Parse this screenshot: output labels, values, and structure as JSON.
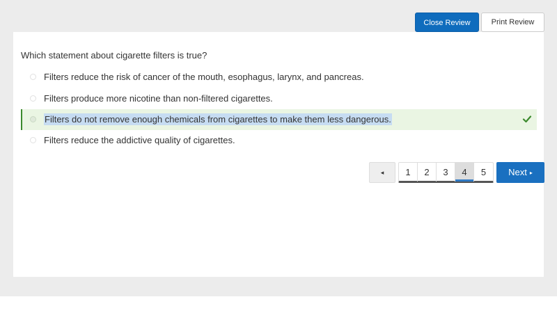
{
  "header": {
    "close_review_label": "Close Review",
    "print_review_label": "Print Review"
  },
  "question": {
    "text": "Which statement about cigarette filters is true?",
    "options": [
      {
        "text": "Filters reduce the risk of cancer of the mouth, esophagus, larynx, and pancreas.",
        "correct": false
      },
      {
        "text": "Filters produce more nicotine than non-filtered cigarettes.",
        "correct": false
      },
      {
        "text": "Filters do not remove enough chemicals from cigarettes to make them less dangerous.",
        "correct": true
      },
      {
        "text": "Filters reduce the addictive quality of cigarettes.",
        "correct": false
      }
    ]
  },
  "pagination": {
    "prev_icon": "◂",
    "pages": [
      "1",
      "2",
      "3",
      "4",
      "5"
    ],
    "current_page": "4",
    "next_label": "Next",
    "next_icon": "▸"
  },
  "colors": {
    "primary": "#0f6cbd",
    "correct_bg": "#eaf5e3",
    "correct_border": "#3c8a2e"
  }
}
